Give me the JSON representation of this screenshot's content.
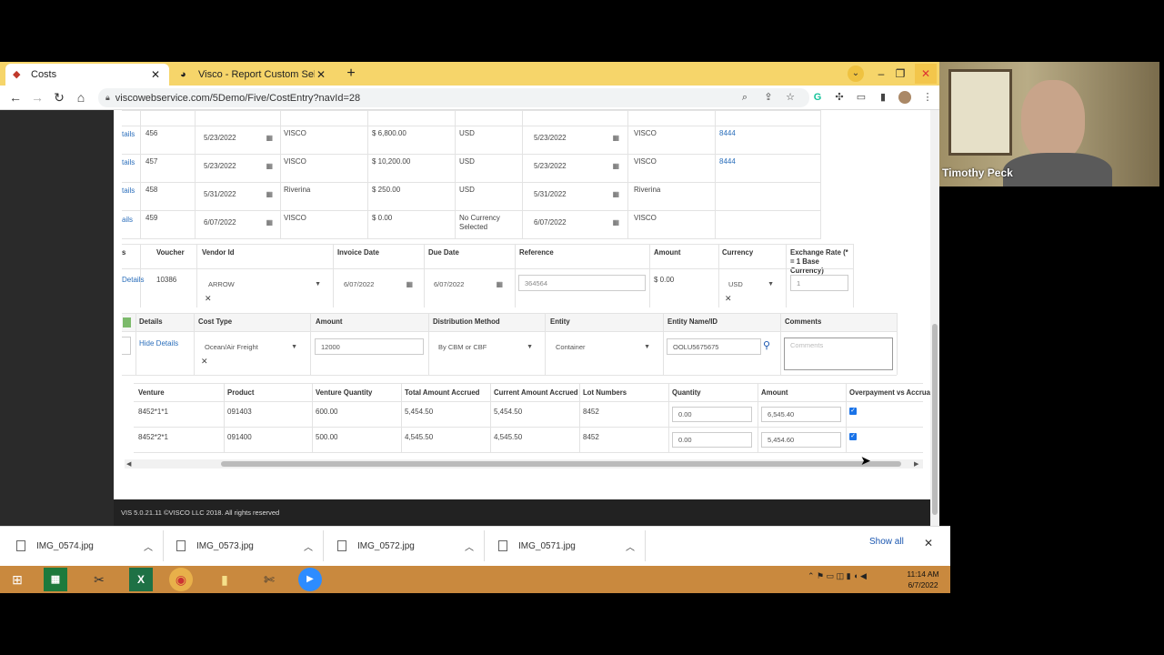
{
  "browser": {
    "tabs": [
      {
        "label": "Costs"
      },
      {
        "label": "Visco - Report Custom Select Pa"
      }
    ],
    "url": "viscowebservice.com/5Demo/Five/CostEntry?navId=28"
  },
  "top_rows": [
    {
      "link": "tails",
      "id": "456",
      "invoice_date": "5/23/2022",
      "vendor": "VISCO",
      "amount": "$ 6,800.00",
      "currency": "USD",
      "due_date": "5/23/2022",
      "ref_vendor": "VISCO",
      "ref": "8444"
    },
    {
      "link": "tails",
      "id": "457",
      "invoice_date": "5/23/2022",
      "vendor": "VISCO",
      "amount": "$ 10,200.00",
      "currency": "USD",
      "due_date": "5/23/2022",
      "ref_vendor": "VISCO",
      "ref": "8444"
    },
    {
      "link": "tails",
      "id": "458",
      "invoice_date": "5/31/2022",
      "vendor": "Riverina",
      "amount": "$ 250.00",
      "currency": "USD",
      "due_date": "5/31/2022",
      "ref_vendor": "Riverina",
      "ref": ""
    },
    {
      "link": "ails",
      "id": "459",
      "invoice_date": "6/07/2022",
      "vendor": "VISCO",
      "amount": "$ 0.00",
      "currency": "No Currency Selected",
      "due_date": "6/07/2022",
      "ref_vendor": "VISCO",
      "ref": ""
    }
  ],
  "voucher_headers": {
    "first": "s",
    "voucher": "Voucher",
    "vendor_id": "Vendor Id",
    "invoice_date": "Invoice Date",
    "due_date": "Due Date",
    "reference": "Reference",
    "amount": "Amount",
    "currency": "Currency",
    "exchange_rate": "Exchange Rate (* = 1 Base Currency)"
  },
  "voucher_row": {
    "link": "Details",
    "voucher": "10386",
    "vendor": "ARROW",
    "invoice_date": "6/07/2022",
    "due_date": "6/07/2022",
    "reference": "364564",
    "amount": "$ 0.00",
    "currency": "USD",
    "exchange_rate": "1"
  },
  "cost_headers": {
    "details": "Details",
    "cost_type": "Cost Type",
    "amount": "Amount",
    "distribution": "Distribution Method",
    "entity": "Entity",
    "entity_name": "Entity Name/ID",
    "comments": "Comments"
  },
  "cost_row": {
    "link": "Hide Details",
    "cost_type": "Ocean/Air Freight",
    "amount": "12000",
    "distribution": "By CBM or CBF",
    "entity": "Container",
    "entity_name": "OOLU5675675",
    "comments_placeholder": "Comments"
  },
  "venture_headers": {
    "venture": "Venture",
    "product": "Product",
    "venture_qty": "Venture Quantity",
    "total_accrued": "Total Amount Accrued",
    "current_accrued": "Current Amount Accrued",
    "lot_numbers": "Lot Numbers",
    "quantity": "Quantity",
    "amount": "Amount",
    "overpayment": "Overpayment vs Accrual"
  },
  "venture_rows": [
    {
      "venture": "8452*1*1",
      "product": "091403",
      "venture_qty": "600.00",
      "total_accrued": "5,454.50",
      "current_accrued": "5,454.50",
      "lot": "8452",
      "quantity": "0.00",
      "amount": "6,545.40"
    },
    {
      "venture": "8452*2*1",
      "product": "091400",
      "venture_qty": "500.00",
      "total_accrued": "4,545.50",
      "current_accrued": "4,545.50",
      "lot": "8452",
      "quantity": "0.00",
      "amount": "5,454.60"
    }
  ],
  "footer_text": "VIS 5.0.21.11 ©VISCO LLC 2018. All rights reserved",
  "downloads": [
    "IMG_0574.jpg",
    "IMG_0573.jpg",
    "IMG_0572.jpg",
    "IMG_0571.jpg"
  ],
  "show_all": "Show all",
  "clock": {
    "time": "11:14 AM",
    "date": "6/7/2022"
  },
  "webcam_name": "Timothy Peck",
  "colors": {
    "tabbar": "#f6d56a",
    "taskbar": "#c9893e",
    "link": "#2a6ebb"
  }
}
